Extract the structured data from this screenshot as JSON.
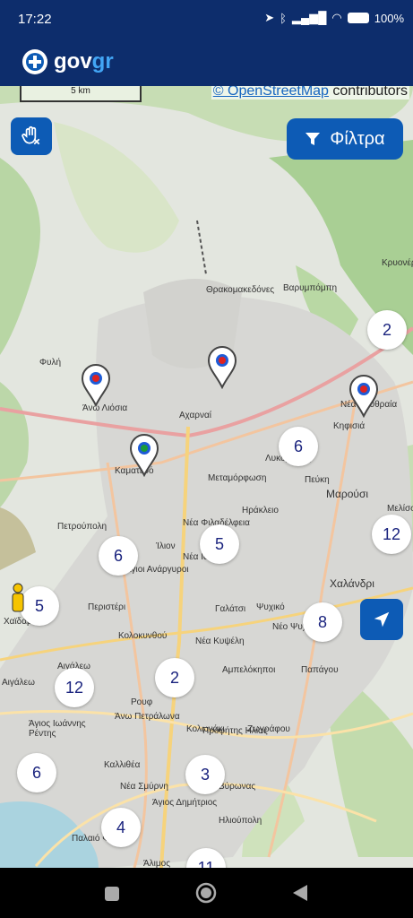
{
  "status_bar": {
    "time": "17:22",
    "battery": "100%"
  },
  "app": {
    "logo_text": "gov",
    "logo_accent": "gr"
  },
  "map": {
    "scale_label": "5 km",
    "attribution_link": "© OpenStreetMap",
    "attribution_text": " contributors",
    "filter_label": "Φίλτρα",
    "clusters": [
      "2",
      "6",
      "12",
      "6",
      "5",
      "5",
      "8",
      "12",
      "2",
      "6",
      "3",
      "4",
      "11"
    ],
    "places": [
      "Θρακομακεδόνες",
      "Βαρυμπόμπη",
      "Κρυονέρι",
      "Φυλή",
      "Άνω Λιόσια",
      "Αχαρναί",
      "Νέα Ερυθραία",
      "Κηφισιά",
      "Καματερό",
      "Μεταμόρφωση",
      "Λυκόβρυση",
      "Πεύκη",
      "Μαρούσι",
      "Πετρούπολη",
      "Νέα Φιλαδέλφεια",
      "Ηράκλειο",
      "Ίλιον",
      "Νέα Ιωνία",
      "Άγιοι Ανάργυροι",
      "Χαλάνδρι",
      "Περιστέρι",
      "Γαλάτσι",
      "Ψυχικό",
      "Νέο Ψυχικό",
      "Χαϊδάρι",
      "Κολοκυνθού",
      "Νέα Κυψέλη",
      "Αιγάλεω",
      "Παπάγου",
      "Αμπελόκηποι",
      "Αιγάλεω",
      "Άνω Πετράλωνα",
      "Κολωνάκι",
      "Ζωγράφου",
      "Άγιος Ιωάννης Ρέντης",
      "Ρουφ",
      "Προφήτης Ηλίας",
      "Καλλιθέα",
      "Νέα Σμύρνη",
      "Ηλιούπολη",
      "Παλαιό Φάληρο",
      "Άλιμος",
      "Μελίσσια",
      "Άγιος Δημήτριος",
      "Βύρωνας"
    ]
  },
  "colors": {
    "primary": "#0d5bb5",
    "dark_blue": "#0d2d6c",
    "cluster_text": "#1a237e"
  }
}
